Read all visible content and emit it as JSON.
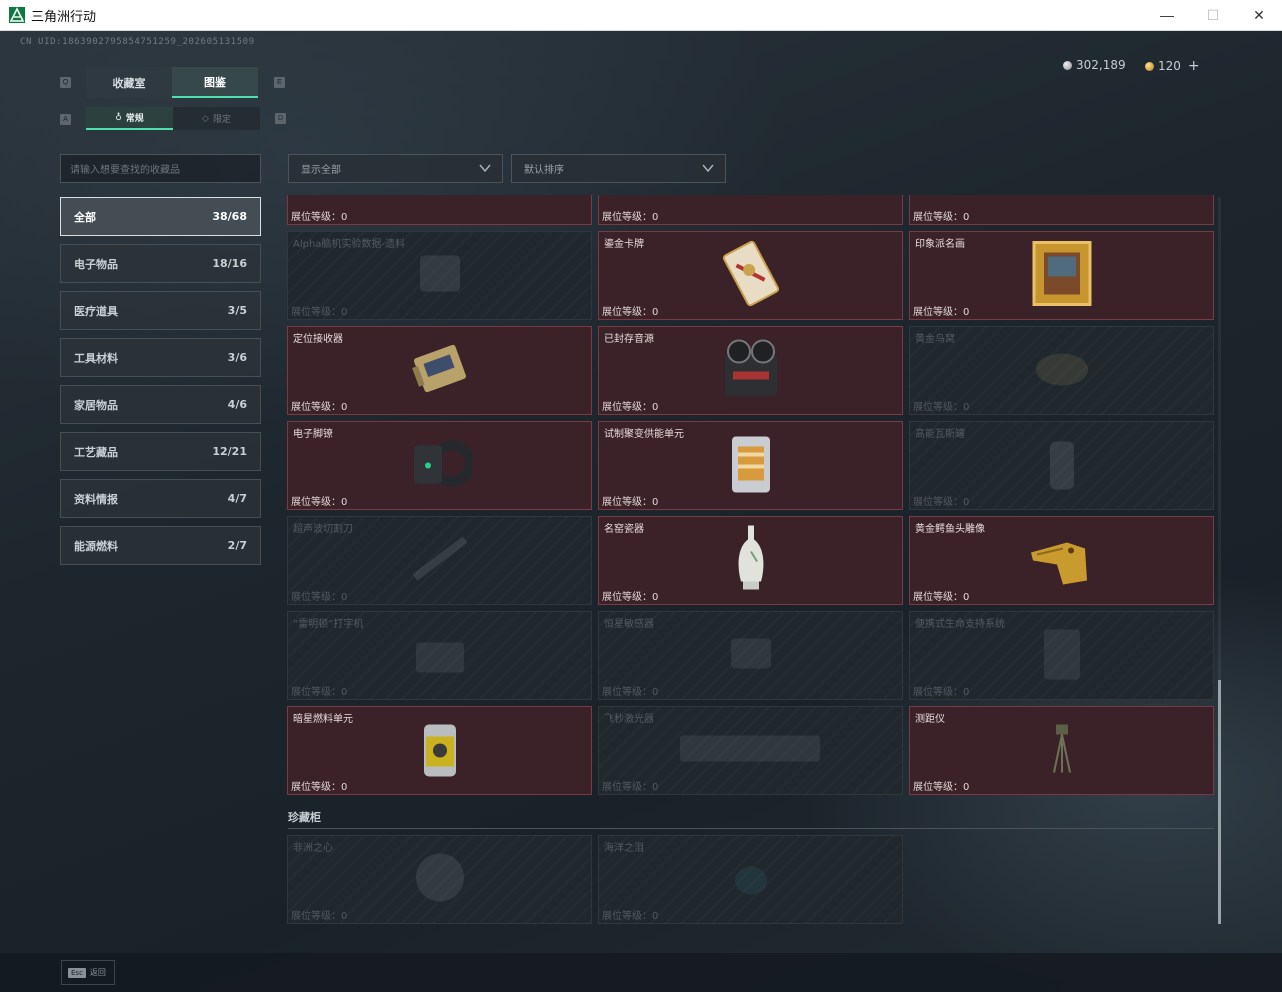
{
  "window": {
    "title": "三角洲行动",
    "minimize_glyph": "—",
    "maximize_glyph": "☐",
    "close_glyph": "✕"
  },
  "uid": "CN UID:186390279585475125​9_202605131509",
  "currency": {
    "silver": "302,189",
    "gold": "120",
    "add": "+"
  },
  "hints": {
    "tab_left": "Q",
    "tab_right": "E",
    "subtab_left": "A",
    "subtab_right": "D"
  },
  "tabs": [
    {
      "label": "收藏室"
    },
    {
      "label": "图鉴"
    }
  ],
  "subtabs": [
    {
      "label": "常规"
    },
    {
      "label": "限定"
    }
  ],
  "search": {
    "placeholder": "请输入想要查找的收藏品"
  },
  "categories": [
    {
      "label": "全部",
      "count": "38/68"
    },
    {
      "label": "电子物品",
      "count": "18/16"
    },
    {
      "label": "医疗道具",
      "count": "3/5"
    },
    {
      "label": "工具材料",
      "count": "3/6"
    },
    {
      "label": "家居物品",
      "count": "4/6"
    },
    {
      "label": "工艺藏品",
      "count": "12/21"
    },
    {
      "label": "资料情报",
      "count": "4/7"
    },
    {
      "label": "能源燃料",
      "count": "2/7"
    }
  ],
  "filters": {
    "show": "显示全部",
    "sort": "默认排序"
  },
  "level_label": "展位等级：",
  "items": [
    {
      "name": "",
      "level": "0",
      "owned": true,
      "icon": "coin-icon"
    },
    {
      "name": "",
      "level": "0",
      "owned": true,
      "icon": "chain-icon"
    },
    {
      "name": "",
      "level": "0",
      "owned": true,
      "icon": "document-icon"
    },
    {
      "name": "Alpha脑机实验数据-遗料",
      "level": "0",
      "owned": false,
      "icon": "device-icon"
    },
    {
      "name": "鎏金卡牌",
      "level": "0",
      "owned": true,
      "icon": "card-icon"
    },
    {
      "name": "印象派名画",
      "level": "0",
      "owned": true,
      "icon": "painting-icon"
    },
    {
      "name": "定位接收器",
      "level": "0",
      "owned": true,
      "icon": "receiver-icon"
    },
    {
      "name": "已封存音源",
      "level": "0",
      "owned": true,
      "icon": "tape-recorder-icon"
    },
    {
      "name": "黄金鸟窝",
      "level": "0",
      "owned": false,
      "icon": "nest-icon"
    },
    {
      "name": "电子脚镣",
      "level": "0",
      "owned": true,
      "icon": "ankle-monitor-icon"
    },
    {
      "name": "试制聚变供能单元",
      "level": "0",
      "owned": true,
      "icon": "fusion-cell-icon"
    },
    {
      "name": "高能瓦斯罐",
      "level": "0",
      "owned": false,
      "icon": "gas-canister-icon"
    },
    {
      "name": "超声波切割刀",
      "level": "0",
      "owned": false,
      "icon": "cutter-icon"
    },
    {
      "name": "名窑瓷器",
      "level": "0",
      "owned": true,
      "icon": "vase-icon"
    },
    {
      "name": "黄金鳄鱼头雕像",
      "level": "0",
      "owned": true,
      "icon": "crocodile-statue-icon"
    },
    {
      "name": "“雷明顿”打字机",
      "level": "0",
      "owned": false,
      "icon": "typewriter-icon"
    },
    {
      "name": "恒星敏感器",
      "level": "0",
      "owned": false,
      "icon": "star-sensor-icon"
    },
    {
      "name": "便携式生命支持系统",
      "level": "0",
      "owned": false,
      "icon": "life-support-icon"
    },
    {
      "name": "暗星燃料单元",
      "level": "0",
      "owned": true,
      "icon": "fuel-cell-icon"
    },
    {
      "name": "飞秒激光器",
      "level": "0",
      "owned": false,
      "icon": "laser-icon"
    },
    {
      "name": "测距仪",
      "level": "0",
      "owned": true,
      "icon": "rangefinder-icon"
    }
  ],
  "showcase": {
    "title": "珍藏柜",
    "items": [
      {
        "name": "非洲之心",
        "level": "0",
        "owned": false,
        "icon": "gem-icon"
      },
      {
        "name": "海洋之泪",
        "level": "0",
        "owned": false,
        "icon": "teardrop-gem-icon"
      }
    ]
  },
  "footer": {
    "esc_key": "Esc",
    "esc_label": "返回"
  }
}
